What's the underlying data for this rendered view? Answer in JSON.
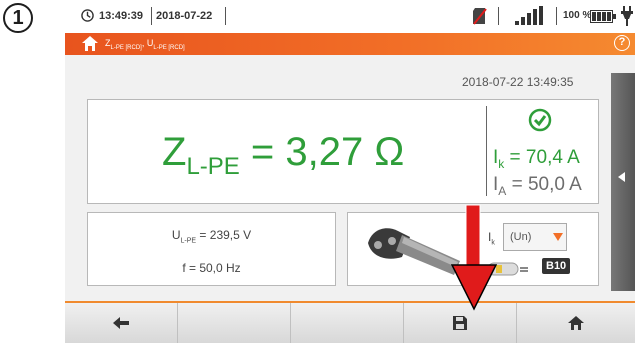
{
  "step_number": "1",
  "status_bar": {
    "time": "13:49:39",
    "date": "2018-07-22",
    "battery_percent": "100 %"
  },
  "title_bar": {
    "z_main": "Z",
    "z_sub": "L-PE [RCD]",
    "sep": ", ",
    "u_main": "U",
    "u_sub": "L-PE [RCD]",
    "help": "?"
  },
  "measurement_datetime": "2018-07-22 13:49:35",
  "result": {
    "zlpe_symbol": "Z",
    "zlpe_sub": "L-PE",
    "zlpe_value": " = 3,27 Ω",
    "ik_symbol": "I",
    "ik_sub": "k",
    "ik_value": " = 70,4 A",
    "ia_symbol": "I",
    "ia_sub": "A",
    "ia_value": " = 50,0 A"
  },
  "aux": {
    "ulpe_symbol": "U",
    "ulpe_sub": "L-PE",
    "ulpe_value": " = 239,5 V",
    "frequency": "f = 50,0 Hz"
  },
  "device": {
    "ik_symbol": "I",
    "ik_sub": "k",
    "dropdown_value": "(Un)",
    "fuse_label": "B10"
  },
  "colors": {
    "accent": "#f26f27",
    "result_green": "#2f9e3a",
    "annotation_red": "#e01b1b"
  },
  "icons": [
    "clock-icon",
    "sd-card-icon",
    "signal-icon",
    "battery-icon",
    "power-plug-icon",
    "home-icon",
    "help-icon",
    "check-circle-icon",
    "chevron-left-icon",
    "dropdown-icon",
    "fuse-icon",
    "arrow-left-icon",
    "save-icon",
    "home-icon"
  ]
}
